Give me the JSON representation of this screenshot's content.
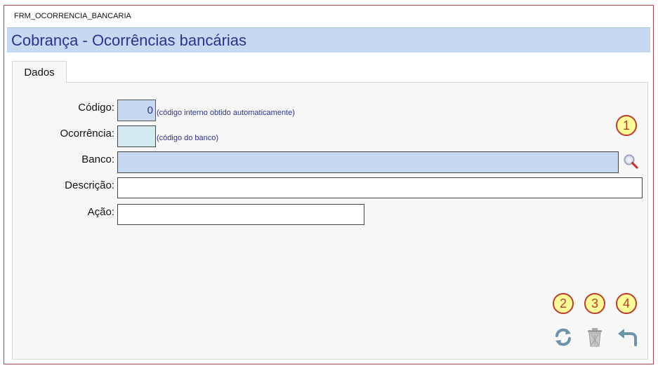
{
  "window": {
    "form_name": "FRM_OCORRENCIA_BANCARIA"
  },
  "header": {
    "title": "Cobrança - Ocorrências bancárias"
  },
  "tabs": [
    {
      "label": "Dados"
    }
  ],
  "fields": {
    "codigo": {
      "label": "Código:",
      "value": "0",
      "hint": "(código interno obtido automaticamente)"
    },
    "ocorrencia": {
      "label": "Ocorrência:",
      "value": "",
      "hint": "(código do banco)"
    },
    "banco": {
      "label": "Banco:",
      "value": ""
    },
    "descricao": {
      "label": "Descrição:",
      "value": ""
    },
    "acao": {
      "label": "Ação:",
      "value": ""
    }
  },
  "callouts": [
    "1",
    "2",
    "3",
    "4"
  ],
  "icons": {
    "lookup": "search-icon",
    "refresh": "refresh-icon",
    "delete": "trash-icon",
    "back": "undo-icon"
  },
  "colors": {
    "title_bar": "#c6d9f1",
    "title_text": "#2e3192",
    "field_blue": "#c6d9f1",
    "field_teal": "#d2ebf0",
    "badge_fill": "#ffff99",
    "badge_border": "#c0392b",
    "window_border": "#b3454f"
  }
}
